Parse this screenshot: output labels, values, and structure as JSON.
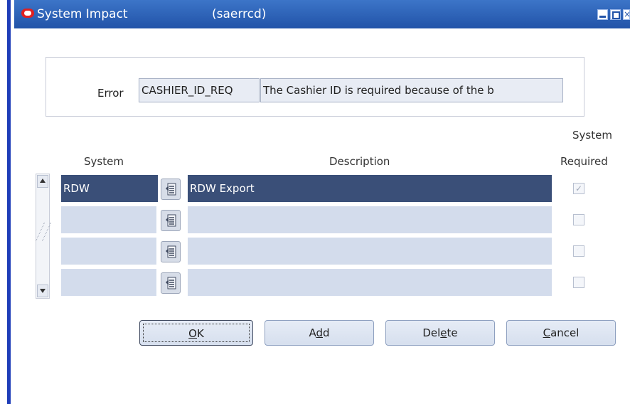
{
  "window": {
    "title": "System Impact",
    "form_code": "(saerrcd)",
    "controls": {
      "minimize": "minimize",
      "maximize": "maximize",
      "close": "×"
    }
  },
  "error_section": {
    "label": "Error",
    "code_value": "CASHIER_ID_REQ",
    "description_value": "The Cashier ID is required because of the b"
  },
  "table": {
    "headers": {
      "system": "System",
      "description": "Description",
      "required_line1": "System",
      "required_line2": "Required"
    },
    "rows": [
      {
        "system": "RDW",
        "description": "RDW Export",
        "required": "✓",
        "selected": true
      },
      {
        "system": "",
        "description": "",
        "required": "",
        "selected": false
      },
      {
        "system": "",
        "description": "",
        "required": "",
        "selected": false
      },
      {
        "system": "",
        "description": "",
        "required": "",
        "selected": false
      }
    ]
  },
  "buttons": {
    "ok": {
      "pre": "",
      "mnemonic": "O",
      "post": "K"
    },
    "add": {
      "pre": "A",
      "mnemonic": "d",
      "post": "d"
    },
    "delete": {
      "pre": "Del",
      "mnemonic": "e",
      "post": "te"
    },
    "cancel": {
      "pre": "",
      "mnemonic": "C",
      "post": "ancel"
    }
  },
  "colors": {
    "titlebar": "#2253a8",
    "selected_row": "#3a4f78",
    "row_bg": "#d3dcec"
  }
}
